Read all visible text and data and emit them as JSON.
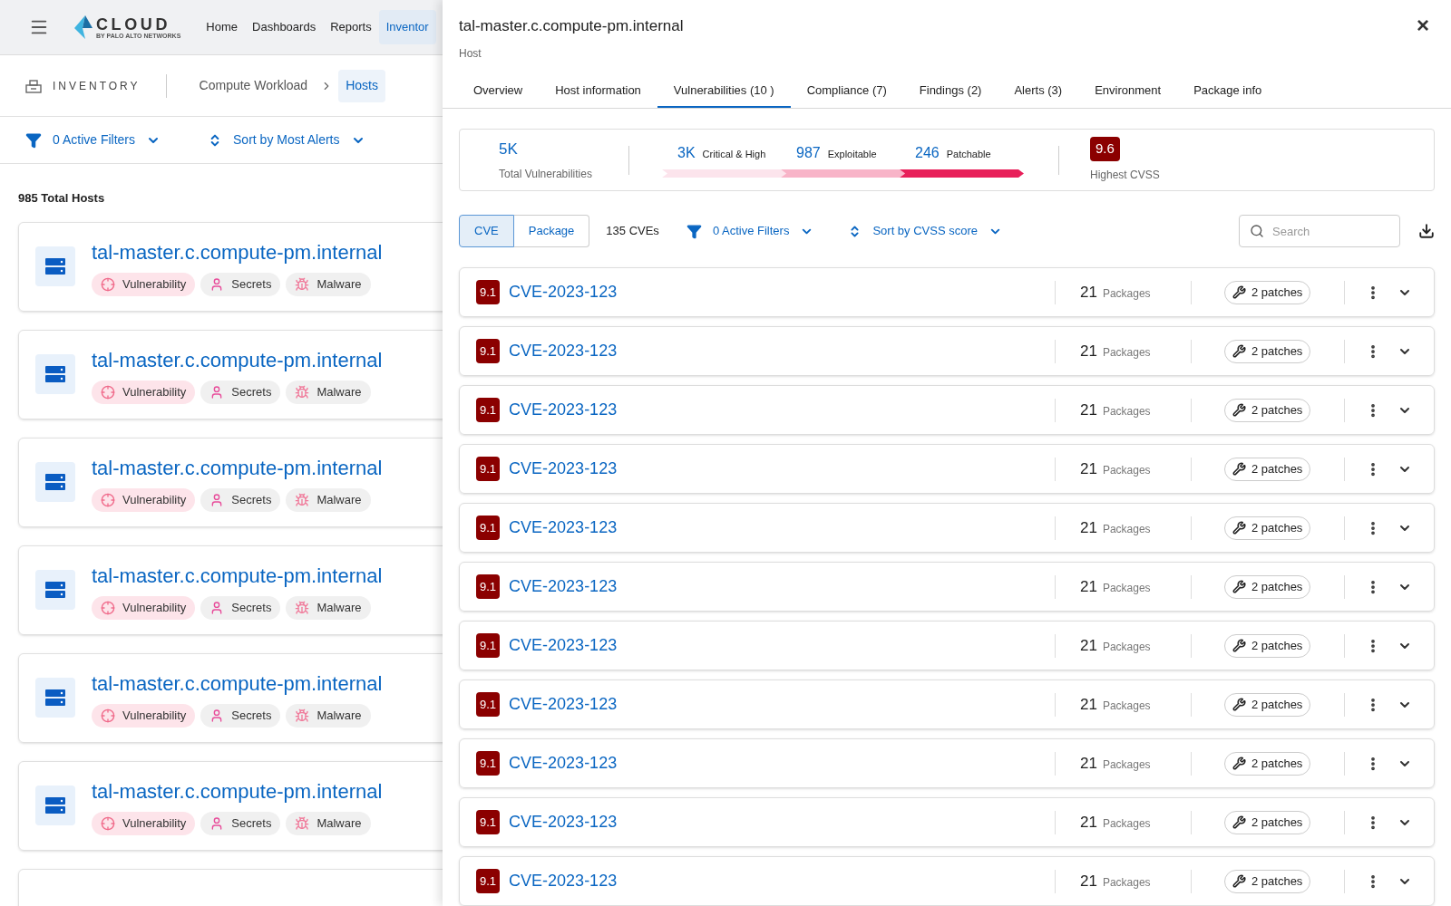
{
  "topbar": {
    "logo": {
      "name": "CLOUD",
      "tagline": "BY PALO ALTO NETWORKS"
    },
    "nav": [
      {
        "label": "Home",
        "selected": false
      },
      {
        "label": "Dashboards",
        "selected": false
      },
      {
        "label": "Reports",
        "selected": false
      },
      {
        "label": "Inventor",
        "selected": true
      }
    ]
  },
  "breadcrumb": {
    "section": "INVENTORY",
    "items": [
      {
        "label": "Compute Workload",
        "selected": false
      },
      {
        "label": "Hosts",
        "selected": true
      }
    ]
  },
  "list_toolbar": {
    "filters": "0 Active Filters",
    "sort": "Sort by Most Alerts"
  },
  "total": "985 Total Hosts",
  "hosts": [
    {
      "name": "tal-master.c.compute-pm.internal",
      "tags": [
        {
          "kind": "vulnerability",
          "label": "Vulnerability"
        },
        {
          "kind": "secrets",
          "label": "Secrets"
        },
        {
          "kind": "malware",
          "label": "Malware"
        }
      ]
    },
    {
      "name": "tal-master.c.compute-pm.internal",
      "tags": [
        {
          "kind": "vulnerability",
          "label": "Vulnerability"
        },
        {
          "kind": "secrets",
          "label": "Secrets"
        },
        {
          "kind": "malware",
          "label": "Malware"
        }
      ]
    },
    {
      "name": "tal-master.c.compute-pm.internal",
      "tags": [
        {
          "kind": "vulnerability",
          "label": "Vulnerability"
        },
        {
          "kind": "secrets",
          "label": "Secrets"
        },
        {
          "kind": "malware",
          "label": "Malware"
        }
      ]
    },
    {
      "name": "tal-master.c.compute-pm.internal",
      "tags": [
        {
          "kind": "vulnerability",
          "label": "Vulnerability"
        },
        {
          "kind": "secrets",
          "label": "Secrets"
        },
        {
          "kind": "malware",
          "label": "Malware"
        }
      ]
    },
    {
      "name": "tal-master.c.compute-pm.internal",
      "tags": [
        {
          "kind": "vulnerability",
          "label": "Vulnerability"
        },
        {
          "kind": "secrets",
          "label": "Secrets"
        },
        {
          "kind": "malware",
          "label": "Malware"
        }
      ]
    },
    {
      "name": "tal-master.c.compute-pm.internal",
      "tags": [
        {
          "kind": "vulnerability",
          "label": "Vulnerability"
        },
        {
          "kind": "secrets",
          "label": "Secrets"
        },
        {
          "kind": "malware",
          "label": "Malware"
        }
      ]
    }
  ],
  "drawer": {
    "title": "tal-master.c.compute-pm.internal",
    "subtitle": "Host",
    "close": "×",
    "tabs": [
      {
        "label": "Overview",
        "selected": false
      },
      {
        "label": "Host information",
        "selected": false
      },
      {
        "label": "Vulnerabilities (10 )",
        "selected": true
      },
      {
        "label": "Compliance (7)",
        "selected": false
      },
      {
        "label": "Findings (2)",
        "selected": false
      },
      {
        "label": "Alerts (3)",
        "selected": false
      },
      {
        "label": "Environment",
        "selected": false
      },
      {
        "label": "Package info",
        "selected": false
      }
    ],
    "summary": {
      "total": {
        "value": "5K",
        "label": "Total Vulnerabilities"
      },
      "segments": [
        {
          "value": "3K",
          "label": "Critical & High",
          "color": "#fce4ec"
        },
        {
          "value": "987",
          "label": "Exploitable",
          "color": "#f8b4c8"
        },
        {
          "value": "246",
          "label": "Patchable",
          "color": "#e8205a"
        }
      ],
      "highest": {
        "value": "9.6",
        "label": "Highest CVSS"
      }
    },
    "toolbar": {
      "views": [
        {
          "label": "CVE",
          "selected": true
        },
        {
          "label": "Package",
          "selected": false
        }
      ],
      "count": "135 CVEs",
      "filters": "0 Active Filters",
      "sort": "Sort by CVSS score",
      "search_placeholder": "Search"
    },
    "cves": [
      {
        "score": "9.1",
        "id": "CVE-2023-123",
        "packages": "21",
        "packages_label": "Packages",
        "patches": "2 patches"
      },
      {
        "score": "9.1",
        "id": "CVE-2023-123",
        "packages": "21",
        "packages_label": "Packages",
        "patches": "2 patches"
      },
      {
        "score": "9.1",
        "id": "CVE-2023-123",
        "packages": "21",
        "packages_label": "Packages",
        "patches": "2 patches"
      },
      {
        "score": "9.1",
        "id": "CVE-2023-123",
        "packages": "21",
        "packages_label": "Packages",
        "patches": "2 patches"
      },
      {
        "score": "9.1",
        "id": "CVE-2023-123",
        "packages": "21",
        "packages_label": "Packages",
        "patches": "2 patches"
      },
      {
        "score": "9.1",
        "id": "CVE-2023-123",
        "packages": "21",
        "packages_label": "Packages",
        "patches": "2 patches"
      },
      {
        "score": "9.1",
        "id": "CVE-2023-123",
        "packages": "21",
        "packages_label": "Packages",
        "patches": "2 patches"
      },
      {
        "score": "9.1",
        "id": "CVE-2023-123",
        "packages": "21",
        "packages_label": "Packages",
        "patches": "2 patches"
      },
      {
        "score": "9.1",
        "id": "CVE-2023-123",
        "packages": "21",
        "packages_label": "Packages",
        "patches": "2 patches"
      },
      {
        "score": "9.1",
        "id": "CVE-2023-123",
        "packages": "21",
        "packages_label": "Packages",
        "patches": "2 patches"
      },
      {
        "score": "9.1",
        "id": "CVE-2023-123",
        "packages": "21",
        "packages_label": "Packages",
        "patches": "2 patches"
      }
    ]
  }
}
